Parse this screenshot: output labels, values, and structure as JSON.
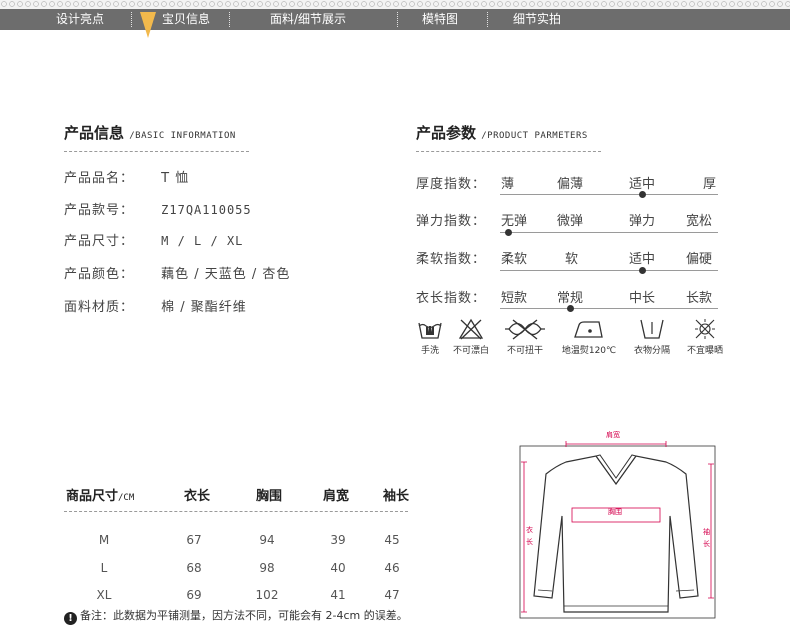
{
  "nav": {
    "items": [
      "设计亮点",
      "宝贝信息",
      "面料/细节展示",
      "模特图",
      "细节实拍"
    ]
  },
  "product_info": {
    "title": "产品信息",
    "subtitle": "/BASIC INFORMATION",
    "rows": [
      {
        "label": "产品品名：",
        "value": "T 恤"
      },
      {
        "label": "产品款号：",
        "value": "Z17QA110055"
      },
      {
        "label": "产品尺寸：",
        "value": "M / L / XL"
      },
      {
        "label": "产品颜色：",
        "value": "藕色 / 天蓝色 / 杏色"
      },
      {
        "label": "面料材质：",
        "value": "棉 / 聚酯纤维"
      }
    ]
  },
  "params": {
    "title": "产品参数",
    "subtitle": "/PRODUCT PARMETERS",
    "rows": [
      {
        "label": "厚度指数：",
        "options": [
          "薄",
          "偏薄",
          "适中",
          "厚"
        ],
        "selected_index": 2
      },
      {
        "label": "弹力指数：",
        "options": [
          "无弹",
          "微弹",
          "弹力",
          "宽松"
        ],
        "selected_index": 0
      },
      {
        "label": "柔软指数：",
        "options": [
          "柔软",
          "软",
          "适中",
          "偏硬"
        ],
        "selected_index": 2
      },
      {
        "label": "衣长指数：",
        "options": [
          "短款",
          "常规",
          "中长",
          "长款"
        ],
        "selected_index": 1
      }
    ],
    "care": [
      {
        "icon": "hand-wash-icon",
        "label": "手洗"
      },
      {
        "icon": "no-bleach-icon",
        "label": "不可漂白"
      },
      {
        "icon": "no-wring-icon",
        "label": "不可扭干"
      },
      {
        "icon": "low-iron-icon",
        "label": "地温熨120℃"
      },
      {
        "icon": "separate-wash-icon",
        "label": "衣物分隔"
      },
      {
        "icon": "no-sun-dry-icon",
        "label": "不宜曝晒"
      }
    ]
  },
  "size_table": {
    "title": "商品尺寸",
    "unit": "/CM",
    "headers": [
      "衣长",
      "胸围",
      "肩宽",
      "袖长"
    ],
    "rows": [
      {
        "size": "M",
        "values": [
          "67",
          "94",
          "39",
          "45"
        ]
      },
      {
        "size": "L",
        "values": [
          "68",
          "98",
          "40",
          "46"
        ]
      },
      {
        "size": "XL",
        "values": [
          "69",
          "102",
          "41",
          "47"
        ]
      }
    ],
    "note": "备注：此数据为平铺测量，因方法不同，可能会有 2-4cm 的误差。",
    "note_icon": "!"
  },
  "measure_diagram": {
    "shoulder": "肩宽",
    "chest": "胸围",
    "length": "衣长",
    "sleeve": "袖长",
    "accent_color": "#d4004c"
  }
}
